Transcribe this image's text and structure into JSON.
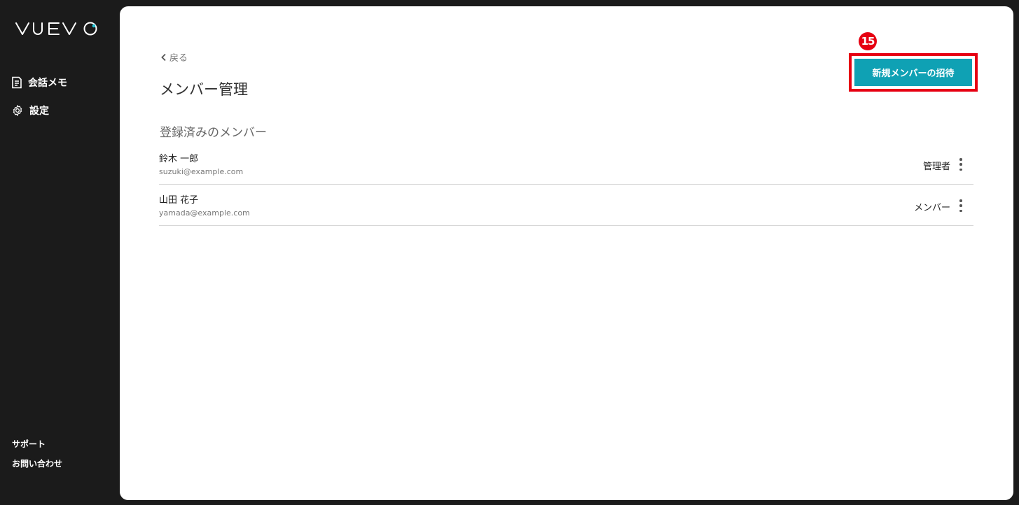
{
  "sidebar": {
    "logo_text": "VUEVO",
    "items": [
      {
        "label": "会話メモ",
        "icon": "memo-icon"
      },
      {
        "label": "設定",
        "icon": "gear-icon"
      }
    ],
    "footer": {
      "support": "サポート",
      "contact": "お問い合わせ"
    }
  },
  "main": {
    "back_label": "戻る",
    "title": "メンバー管理",
    "section_title": "登録済みのメンバー",
    "invite_button": "新規メンバーの招待",
    "annotation_number": "15",
    "members": [
      {
        "name": "鈴木 一郎",
        "email": "suzuki@example.com",
        "role": "管理者"
      },
      {
        "name": "山田 花子",
        "email": "yamada@example.com",
        "role": "メンバー"
      }
    ]
  },
  "colors": {
    "sidebar_bg": "#1b1b1b",
    "accent": "#0fa1b4",
    "highlight": "#e60012"
  }
}
